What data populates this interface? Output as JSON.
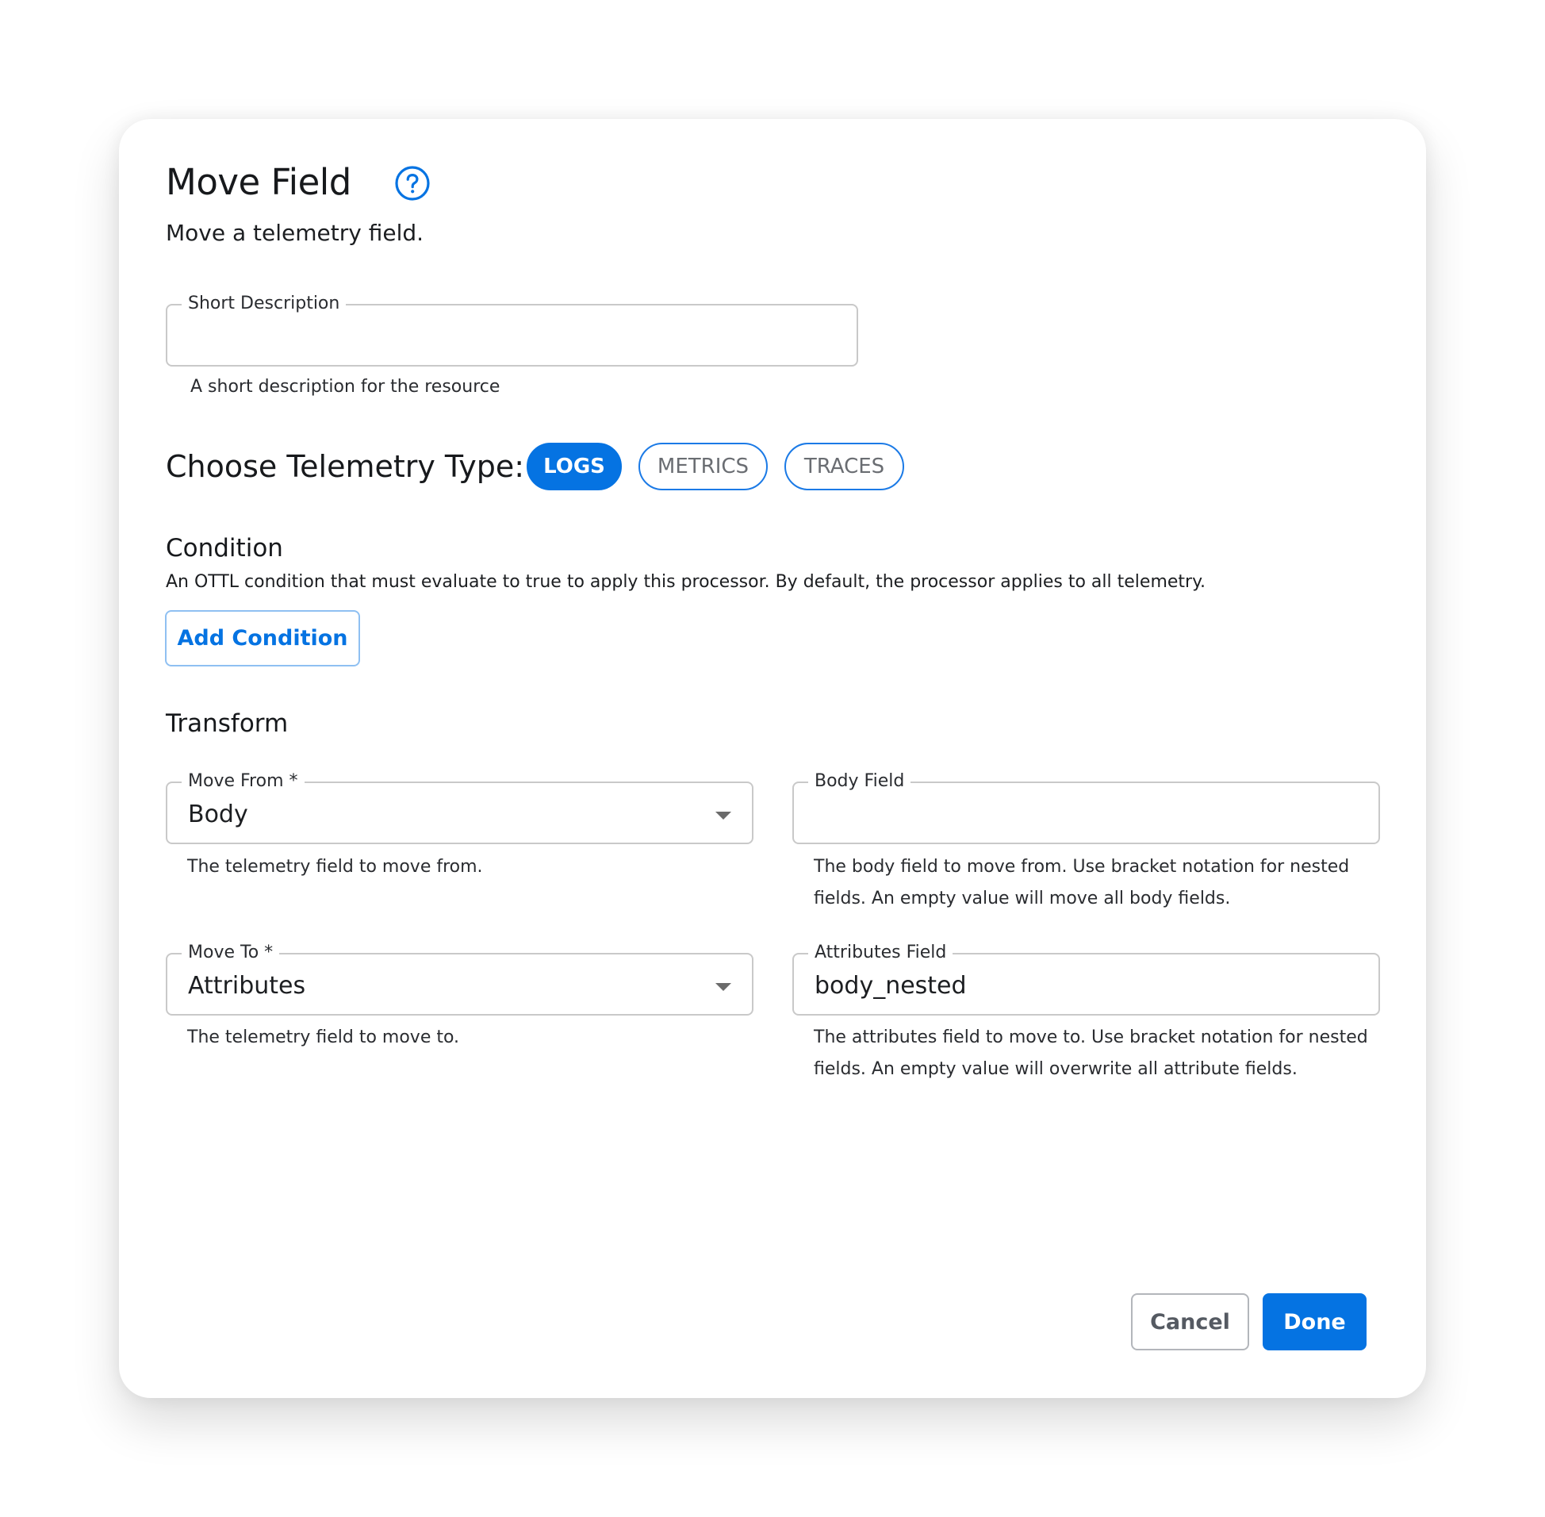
{
  "dialog": {
    "title": "Move Field",
    "help_icon": "question-circle-icon",
    "subtitle": "Move a telemetry field."
  },
  "short_description": {
    "label": "Short Description",
    "value": "",
    "helper": "A short description for the resource"
  },
  "telemetry_type": {
    "label": "Choose Telemetry Type:",
    "options": [
      {
        "label": "LOGS",
        "selected": true
      },
      {
        "label": "METRICS",
        "selected": false
      },
      {
        "label": "TRACES",
        "selected": false
      }
    ]
  },
  "condition": {
    "heading": "Condition",
    "description": "An OTTL condition that must evaluate to true to apply this processor. By default, the processor applies to all telemetry.",
    "add_button": "Add Condition"
  },
  "transform": {
    "heading": "Transform",
    "move_from": {
      "label": "Move From *",
      "value": "Body",
      "helper": "The telemetry field to move from."
    },
    "body_field": {
      "label": "Body Field",
      "value": "",
      "helper_line1": "The body field to move from. Use bracket notation for nested",
      "helper_line2": "fields. An empty value will move all body fields."
    },
    "move_to": {
      "label": "Move To *",
      "value": "Attributes",
      "helper": "The telemetry field to move to."
    },
    "attributes_field": {
      "label": "Attributes Field",
      "value": "body_nested",
      "helper_line1": "The attributes field to move to. Use bracket notation for nested",
      "helper_line2": "fields. An empty value will overwrite all attribute fields."
    }
  },
  "footer": {
    "cancel": "Cancel",
    "done": "Done"
  },
  "colors": {
    "accent": "#0573e2",
    "chip_border": "#1b7ae6",
    "input_border": "#c9c9c9"
  }
}
